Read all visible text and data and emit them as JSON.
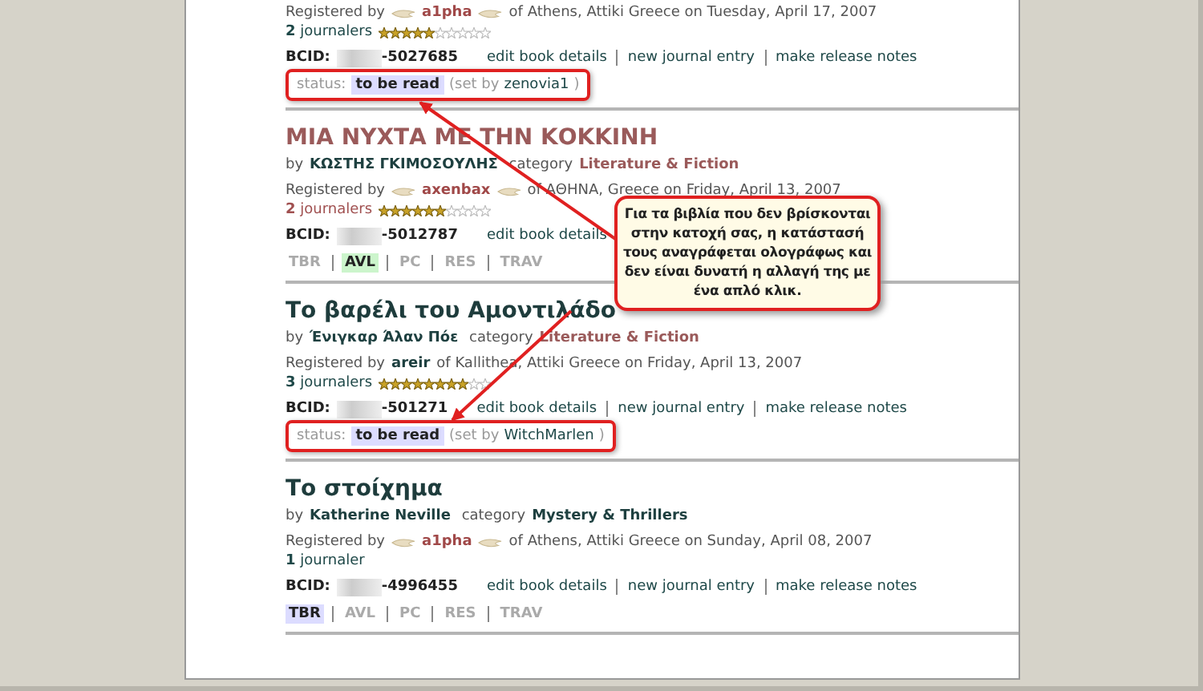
{
  "books": [
    {
      "registered_label": "Registered by",
      "registrar": "a1pha",
      "registrar_wings": true,
      "location": "of Athens, Attiki Greece on Tuesday, April 17, 2007",
      "journaler_count": "2",
      "journaler_label": "journalers",
      "journaler_faded": false,
      "stars": 5,
      "bcid_label": "BCID:",
      "bcid": "-5027685",
      "links": [
        "edit book details",
        "new journal entry",
        "make release notes"
      ],
      "status": {
        "kind": "status",
        "label": "status:",
        "value": "to be read",
        "set_by": "(set by",
        "user": "zenovia1",
        "close": ")",
        "highlighted": true
      }
    },
    {
      "title": "ΜΙΑ ΝΥΧΤΑ ΜΕ ΤΗΝ ΚΟΚΚΙΝΗ",
      "color": "#9a5a5a",
      "by": "by",
      "author": "ΚΩΣΤΗΣ ΓΚΙΜΟΣΟΥΛΗΣ",
      "category_label": "category",
      "category": {
        "label": "Literature & Fiction",
        "color": "#9a5a5a"
      },
      "registered_label": "Registered by",
      "registrar": "axenbax",
      "registrar_wings": true,
      "location": "of ΑΘΗΝΑ,  Greece on Friday, April 13, 2007",
      "journaler_count": "2",
      "journaler_label": "journalers",
      "journaler_faded": true,
      "stars": 6,
      "bcid_label": "BCID:",
      "bcid": "-5012787",
      "links": [
        "edit book details"
      ],
      "status": {
        "kind": "tags",
        "tags": [
          {
            "label": "TBR",
            "selected": false
          },
          {
            "label": "AVL",
            "selected": true
          },
          {
            "label": "PC",
            "selected": false
          },
          {
            "label": "RES",
            "selected": false
          },
          {
            "label": "TRAV",
            "selected": false
          }
        ]
      }
    },
    {
      "title": "Το βαρέλι του Αμοντιλάδο",
      "color": "#1e3c3c",
      "by": "by",
      "author": "Ένιγκαρ Άλαν Πόε",
      "category_label": "category",
      "category": {
        "label": "Literature & Fiction",
        "color": "#9a5a5a"
      },
      "registered_label": "Registered by",
      "registrar": "areir",
      "registrar_wings": false,
      "location": "of Kallithea, Attiki Greece on Friday, April 13, 2007",
      "journaler_count": "3",
      "journaler_label": "journalers",
      "journaler_faded": false,
      "stars": 8,
      "bcid_label": "BCID:",
      "bcid": "-501271",
      "links": [
        "edit book details",
        "new journal entry",
        "make release notes"
      ],
      "status": {
        "kind": "status",
        "label": "status:",
        "value": "to be read",
        "set_by": "(set by",
        "user": "WitchMarlen",
        "close": ")",
        "highlighted": true
      }
    },
    {
      "title": "Το στοίχημα",
      "color": "#1e3c3c",
      "by": "by",
      "author": "Katherine Neville",
      "category_label": "category",
      "category": {
        "label": "Mystery & Thrillers",
        "color": "#1e4040"
      },
      "registered_label": "Registered by",
      "registrar": "a1pha",
      "registrar_wings": true,
      "location": "of Athens, Attiki Greece on Sunday, April 08, 2007",
      "journaler_count": "1",
      "journaler_label": "journaler",
      "journaler_faded": false,
      "bcid_label": "BCID:",
      "bcid": "-4996455",
      "links": [
        "edit book details",
        "new journal entry",
        "make release notes"
      ],
      "status": {
        "kind": "tags",
        "tags": [
          {
            "label": "TBR",
            "selected": true
          },
          {
            "label": "AVL",
            "selected": false
          },
          {
            "label": "PC",
            "selected": false
          },
          {
            "label": "RES",
            "selected": false
          },
          {
            "label": "TRAV",
            "selected": false
          }
        ]
      }
    }
  ],
  "callout": {
    "text": "Για τα βιβλία που δεν βρίσκονται στην κατοχή σας, η κατάστασή τους αναγράφεται ολογράφως και δεν είναι δυνατή η αλλαγή της με ένα απλό κλικ."
  }
}
